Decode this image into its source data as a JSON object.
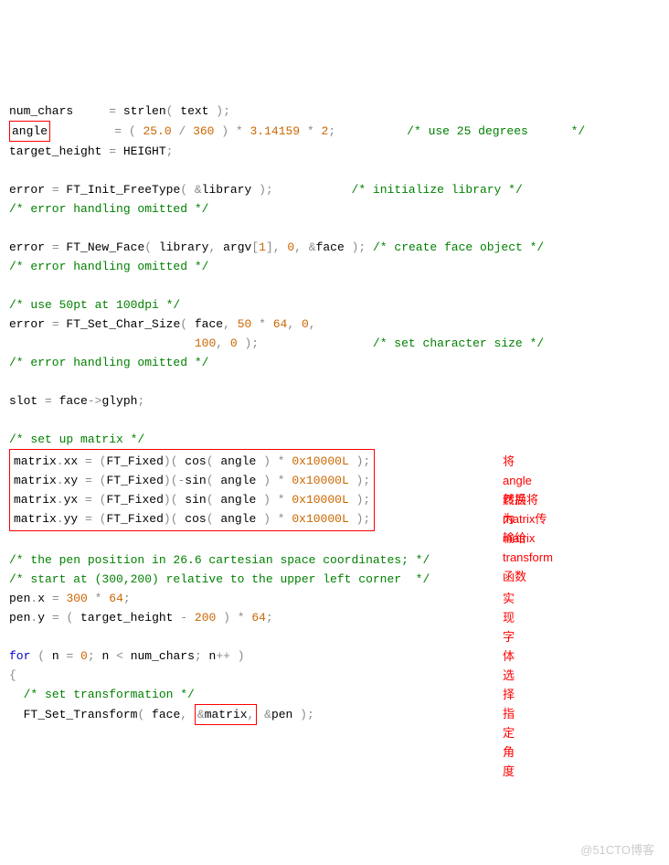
{
  "l00": {
    "a": "num_chars",
    "b": "     ",
    "c": "=",
    "d": " strlen",
    "e": "(",
    "f": " text ",
    "g": ");"
  },
  "l01": {
    "a": "angle",
    "sp": "         ",
    "eq": "=",
    "o1": " (",
    "n1": " 25.0 ",
    "o2": "/",
    "n2": " 360 ",
    "o3": ") *",
    "n3": " 3.14159 ",
    "o4": "*",
    "n4": " 2",
    "o5": ";",
    "sp2": "          ",
    "c": "/* use 25 degrees      */"
  },
  "l02": {
    "a": "target_height ",
    "eq": "=",
    "b": " HEIGHT",
    "sc": ";"
  },
  "l04": {
    "a": "error ",
    "eq": "=",
    "b": " FT_Init_FreeType",
    "p1": "( &",
    "c": "library ",
    "p2": ");",
    "sp": "           ",
    "cm": "/* initialize library */"
  },
  "l05": {
    "c": "/* error handling omitted */"
  },
  "l07": {
    "a": "error ",
    "eq": "=",
    "b": " FT_New_Face",
    "p1": "(",
    "c": " library",
    "cm1": ",",
    "d": " argv",
    "br": "[",
    "n": "1",
    "br2": "],",
    "n2": " 0",
    "cm2": ", &",
    "e": "face ",
    "p2": ");",
    "cm": " /* create face object */"
  },
  "l08": {
    "c": "/* error handling omitted */"
  },
  "l10": {
    "c": "/* use 50pt at 100dpi */"
  },
  "l11": {
    "a": "error ",
    "eq": "=",
    "b": " FT_Set_Char_Size",
    "p1": "(",
    "c": " face",
    "cm1": ",",
    "n1": " 50 ",
    "st": "*",
    "n2": " 64",
    "cm2": ",",
    "n3": " 0",
    "cm3": ","
  },
  "l12": {
    "sp": "                          ",
    "n1": "100",
    "cm1": ",",
    "n2": " 0 ",
    "p": ");",
    "sp2": "                ",
    "cm": "/* set character size */"
  },
  "l13": {
    "c": "/* error handling omitted */"
  },
  "l15": {
    "a": "slot ",
    "eq": "=",
    "b": " face",
    "ar": "->",
    "c": "glyph",
    "sc": ";"
  },
  "l17": {
    "c": "/* set up matrix */"
  },
  "m": {
    "xx": {
      "a": "matrix",
      "d": ".",
      "b": "xx ",
      "eq": "=",
      "c": " ",
      "p1": "(",
      "d2": "FT_Fixed",
      "p2": ")(",
      "fn": " cos",
      "p3": "(",
      "ag": " angle ",
      "p4": ") *",
      "hex": " 0x10000L ",
      "p5": ");"
    },
    "xy": {
      "a": "matrix",
      "d": ".",
      "b": "xy ",
      "eq": "=",
      "c": " ",
      "p1": "(",
      "d2": "FT_Fixed",
      "p2": ")(-",
      "fn": "sin",
      "p3": "(",
      "ag": " angle ",
      "p4": ") *",
      "hex": " 0x10000L ",
      "p5": ");"
    },
    "yx": {
      "a": "matrix",
      "d": ".",
      "b": "yx ",
      "eq": "=",
      "c": " ",
      "p1": "(",
      "d2": "FT_Fixed",
      "p2": ")(",
      "fn": " sin",
      "p3": "(",
      "ag": " angle ",
      "p4": ") *",
      "hex": " 0x10000L ",
      "p5": ");"
    },
    "yy": {
      "a": "matrix",
      "d": ".",
      "b": "yy ",
      "eq": "=",
      "c": " ",
      "p1": "(",
      "d2": "FT_Fixed",
      "p2": ")(",
      "fn": " cos",
      "p3": "(",
      "ag": " angle ",
      "p4": ") *",
      "hex": " 0x10000L ",
      "p5": ");"
    }
  },
  "zh1": "将angle转换为matrix",
  "zh2": "然后将matrix传输给transform函数",
  "zh3": "实现字体选择指定角度",
  "l19": {
    "c": "/* the pen position in 26.6 cartesian space coordinates; */"
  },
  "l20": {
    "c": "/* start at (300,200) relative to the upper left corner  */"
  },
  "l21": {
    "a": "pen",
    "d": ".",
    "b": "x ",
    "eq": "=",
    "n1": " 300 ",
    "st": "*",
    "n2": " 64",
    "sc": ";"
  },
  "l22": {
    "a": "pen",
    "d": ".",
    "b": "y ",
    "eq": "=",
    "p1": " (",
    "c": " target_height ",
    "mn": "-",
    "n1": " 200 ",
    "p2": ") *",
    "n2": " 64",
    "sc": ";"
  },
  "l24": {
    "kw": "for ",
    "p1": "(",
    "a": " n ",
    "eq": "=",
    "n1": " 0",
    "sc": ";",
    "b": " n ",
    "lt": "<",
    "c": " num_chars",
    "sc2": ";",
    "d": " n",
    "pp": "++ )"
  },
  "l25": {
    "br": "{"
  },
  "l26": {
    "sp": "  ",
    "c": "/* set transformation */"
  },
  "l27": {
    "sp": "  ",
    "a": "FT_Set_Transform",
    "p1": "(",
    "b": " face",
    "cm": ",",
    "sp2": " ",
    "amp": "&matrix,",
    "sp3": " ",
    "amp2": "&",
    "c": "pen ",
    "p2": ");"
  },
  "watermark": "@51CTO博客"
}
